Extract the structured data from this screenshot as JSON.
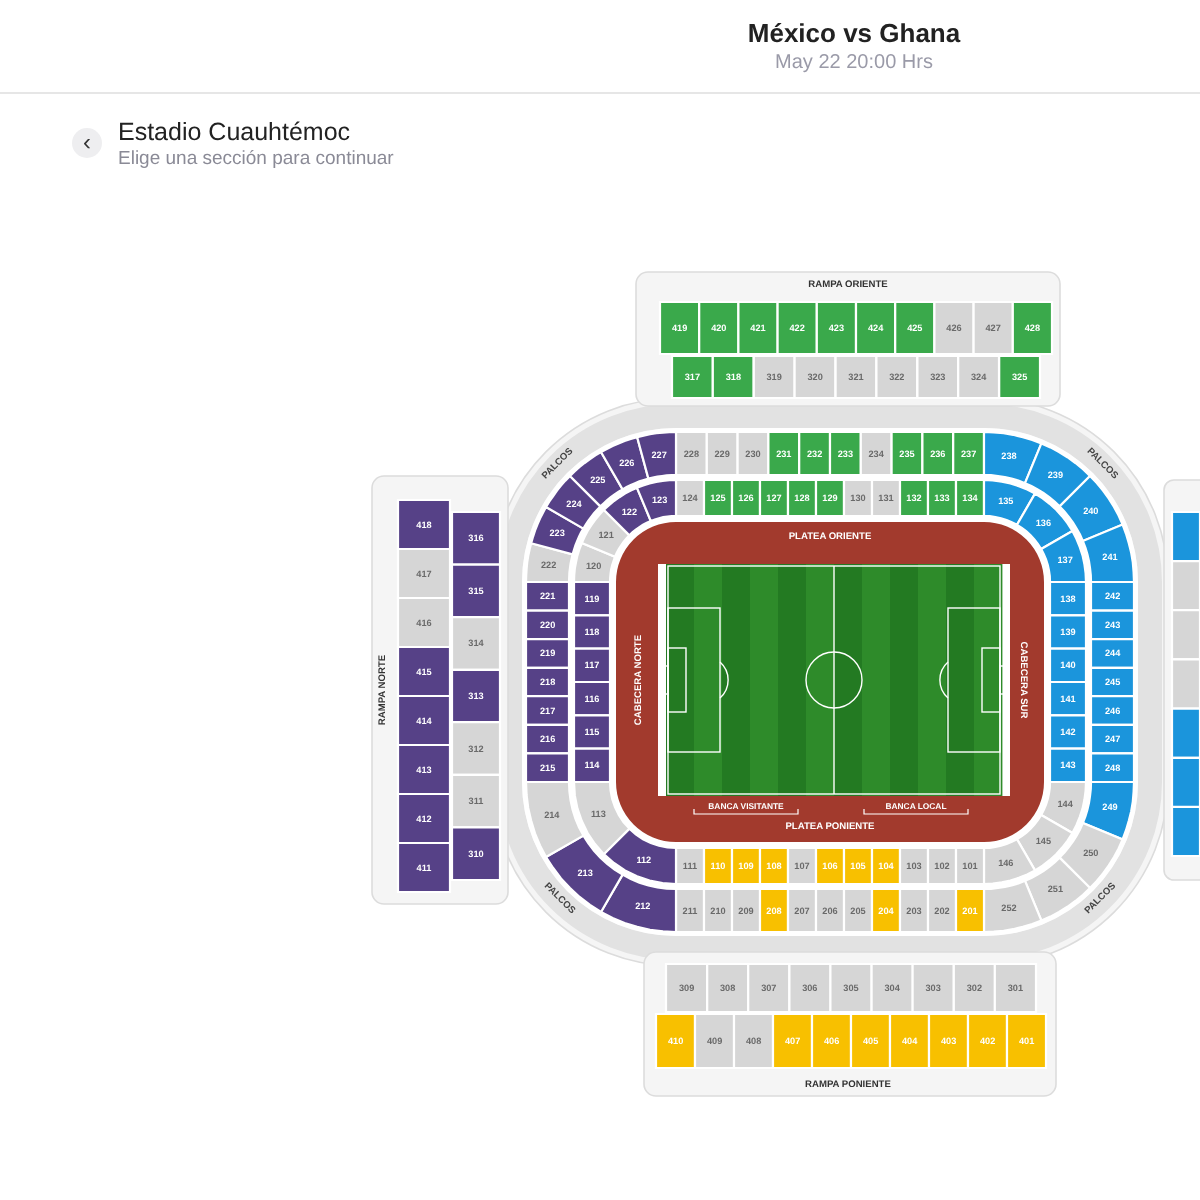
{
  "event": {
    "title": "México vs Ghana",
    "date": "May 22 20:00 Hrs"
  },
  "venue": {
    "back_button": "‹",
    "name": "Estadio Cuauhtémoc",
    "hint": "Elige una sección para continuar"
  },
  "map": {
    "labels": [
      {
        "kind": "ramp",
        "text": "RAMPA ORIENTE"
      },
      {
        "kind": "box",
        "text": "PALCOS"
      },
      {
        "kind": "box",
        "text": "PALCOS"
      },
      {
        "kind": "ramp",
        "text": "RAMPA NORTE"
      },
      {
        "kind": "stand",
        "text": "PLATEA ORIENTE"
      },
      {
        "kind": "stand",
        "text": "CABECERA NORTE"
      },
      {
        "kind": "stand",
        "text": "CABECERA SUR"
      },
      {
        "kind": "bench",
        "text": "BANCA VISITANTE"
      },
      {
        "kind": "bench",
        "text": "BANCA LOCAL"
      },
      {
        "kind": "stand",
        "text": "PLATEA PONIENTE"
      },
      {
        "kind": "box",
        "text": "PALCOS"
      },
      {
        "kind": "box",
        "text": "PALCOS"
      },
      {
        "kind": "ramp",
        "text": "RAMPA PONIENTE"
      }
    ],
    "oriente": {
      "rows": [
        [
          {
            "label": "419",
            "color": "#3aa94b"
          },
          {
            "label": "420",
            "color": "#3aa94b"
          },
          {
            "label": "421",
            "color": "#3aa94b"
          },
          {
            "label": "422",
            "color": "#3aa94b"
          },
          {
            "label": "423",
            "color": "#3aa94b"
          },
          {
            "label": "424",
            "color": "#3aa94b"
          },
          {
            "label": "425",
            "color": "#3aa94b"
          },
          {
            "label": "426",
            "color": "#d6d6d6"
          },
          {
            "label": "427",
            "color": "#d6d6d6"
          },
          {
            "label": "428",
            "color": "#3aa94b"
          }
        ],
        [
          {
            "label": "317",
            "color": "#3aa94b"
          },
          {
            "label": "318",
            "color": "#3aa94b"
          },
          {
            "label": "319",
            "color": "#d6d6d6"
          },
          {
            "label": "320",
            "color": "#d6d6d6"
          },
          {
            "label": "321",
            "color": "#d6d6d6"
          },
          {
            "label": "322",
            "color": "#d6d6d6"
          },
          {
            "label": "323",
            "color": "#d6d6d6"
          },
          {
            "label": "324",
            "color": "#d6d6d6"
          },
          {
            "label": "325",
            "color": "#3aa94b"
          }
        ]
      ]
    },
    "norte": {
      "columns": [
        [
          {
            "label": "418",
            "color": "#564187"
          },
          {
            "label": "417",
            "color": "#d6d6d6"
          },
          {
            "label": "416",
            "color": "#d6d6d6"
          },
          {
            "label": "415",
            "color": "#564187"
          },
          {
            "label": "414",
            "color": "#564187"
          },
          {
            "label": "413",
            "color": "#564187"
          },
          {
            "label": "412",
            "color": "#564187"
          },
          {
            "label": "411",
            "color": "#564187"
          }
        ],
        [
          {
            "label": "316",
            "color": "#564187"
          },
          {
            "label": "315",
            "color": "#564187"
          },
          {
            "label": "314",
            "color": "#d6d6d6"
          },
          {
            "label": "313",
            "color": "#564187"
          },
          {
            "label": "312",
            "color": "#d6d6d6"
          },
          {
            "label": "311",
            "color": "#d6d6d6"
          },
          {
            "label": "310",
            "color": "#564187"
          }
        ]
      ]
    },
    "sur": {
      "columns": [
        [
          {
            "color": "#1b95dc"
          },
          {
            "color": "#d6d6d6"
          },
          {
            "color": "#d6d6d6"
          },
          {
            "color": "#d6d6d6"
          },
          {
            "color": "#1b95dc"
          },
          {
            "color": "#1b95dc"
          },
          {
            "color": "#1b95dc"
          }
        ]
      ]
    },
    "poniente": {
      "rows": [
        [
          {
            "label": "309",
            "color": "#d6d6d6"
          },
          {
            "label": "308",
            "color": "#d6d6d6"
          },
          {
            "label": "307",
            "color": "#d6d6d6"
          },
          {
            "label": "306",
            "color": "#d6d6d6"
          },
          {
            "label": "305",
            "color": "#d6d6d6"
          },
          {
            "label": "304",
            "color": "#d6d6d6"
          },
          {
            "label": "303",
            "color": "#d6d6d6"
          },
          {
            "label": "302",
            "color": "#d6d6d6"
          },
          {
            "label": "301",
            "color": "#d6d6d6"
          }
        ],
        [
          {
            "label": "410",
            "color": "#f8c000"
          },
          {
            "label": "409",
            "color": "#d6d6d6"
          },
          {
            "label": "408",
            "color": "#d6d6d6"
          },
          {
            "label": "407",
            "color": "#f8c000"
          },
          {
            "label": "406",
            "color": "#f8c000"
          },
          {
            "label": "405",
            "color": "#f8c000"
          },
          {
            "label": "404",
            "color": "#f8c000"
          },
          {
            "label": "403",
            "color": "#f8c000"
          },
          {
            "label": "402",
            "color": "#f8c000"
          },
          {
            "label": "401",
            "color": "#f8c000"
          }
        ]
      ]
    },
    "ring_1": {
      "top": [
        {
          "label": "124",
          "color": "#d6d6d6"
        },
        {
          "label": "125",
          "color": "#3aa94b"
        },
        {
          "label": "126",
          "color": "#3aa94b"
        },
        {
          "label": "127",
          "color": "#3aa94b"
        },
        {
          "label": "128",
          "color": "#3aa94b"
        },
        {
          "label": "129",
          "color": "#3aa94b"
        },
        {
          "label": "130",
          "color": "#d6d6d6"
        },
        {
          "label": "131",
          "color": "#d6d6d6"
        },
        {
          "label": "132",
          "color": "#3aa94b"
        },
        {
          "label": "133",
          "color": "#3aa94b"
        },
        {
          "label": "134",
          "color": "#3aa94b"
        }
      ],
      "top_right": [
        {
          "label": "135",
          "color": "#1b95dc"
        },
        {
          "label": "136",
          "color": "#1b95dc"
        },
        {
          "label": "137",
          "color": "#1b95dc"
        }
      ],
      "right": [
        {
          "label": "138",
          "color": "#1b95dc"
        },
        {
          "label": "139",
          "color": "#1b95dc"
        },
        {
          "label": "140",
          "color": "#1b95dc"
        },
        {
          "label": "141",
          "color": "#1b95dc"
        },
        {
          "label": "142",
          "color": "#1b95dc"
        },
        {
          "label": "143",
          "color": "#1b95dc"
        }
      ],
      "bottom_right": [
        {
          "label": "144",
          "color": "#d6d6d6"
        },
        {
          "label": "145",
          "color": "#d6d6d6"
        },
        {
          "label": "146",
          "color": "#d6d6d6"
        }
      ],
      "bottom": [
        {
          "label": "111",
          "color": "#d6d6d6"
        },
        {
          "label": "110",
          "color": "#f8c000"
        },
        {
          "label": "109",
          "color": "#f8c000"
        },
        {
          "label": "108",
          "color": "#f8c000"
        },
        {
          "label": "107",
          "color": "#d6d6d6"
        },
        {
          "label": "106",
          "color": "#f8c000"
        },
        {
          "label": "105",
          "color": "#f8c000"
        },
        {
          "label": "104",
          "color": "#f8c000"
        },
        {
          "label": "103",
          "color": "#d6d6d6"
        },
        {
          "label": "102",
          "color": "#d6d6d6"
        },
        {
          "label": "101",
          "color": "#d6d6d6"
        }
      ],
      "bottom_left": [
        {
          "label": "112",
          "color": "#564187"
        },
        {
          "label": "113",
          "color": "#d6d6d6"
        }
      ],
      "left": [
        {
          "label": "119",
          "color": "#564187"
        },
        {
          "label": "118",
          "color": "#564187"
        },
        {
          "label": "117",
          "color": "#564187"
        },
        {
          "label": "116",
          "color": "#564187"
        },
        {
          "label": "115",
          "color": "#564187"
        },
        {
          "label": "114",
          "color": "#564187"
        }
      ],
      "top_left": [
        {
          "label": "120",
          "color": "#d6d6d6"
        },
        {
          "label": "121",
          "color": "#d6d6d6"
        },
        {
          "label": "122",
          "color": "#564187"
        },
        {
          "label": "123",
          "color": "#564187"
        }
      ]
    },
    "ring_2": {
      "top": [
        {
          "label": "228",
          "color": "#d6d6d6"
        },
        {
          "label": "229",
          "color": "#d6d6d6"
        },
        {
          "label": "230",
          "color": "#d6d6d6"
        },
        {
          "label": "231",
          "color": "#3aa94b"
        },
        {
          "label": "232",
          "color": "#3aa94b"
        },
        {
          "label": "233",
          "color": "#3aa94b"
        },
        {
          "label": "234",
          "color": "#d6d6d6"
        },
        {
          "label": "235",
          "color": "#3aa94b"
        },
        {
          "label": "236",
          "color": "#3aa94b"
        },
        {
          "label": "237",
          "color": "#3aa94b"
        }
      ],
      "top_right": [
        {
          "label": "238",
          "color": "#1b95dc"
        },
        {
          "label": "239",
          "color": "#1b95dc"
        },
        {
          "label": "240",
          "color": "#1b95dc"
        },
        {
          "label": "241",
          "color": "#1b95dc"
        }
      ],
      "right": [
        {
          "label": "242",
          "color": "#1b95dc"
        },
        {
          "label": "243",
          "color": "#1b95dc"
        },
        {
          "label": "244",
          "color": "#1b95dc"
        },
        {
          "label": "245",
          "color": "#1b95dc"
        },
        {
          "label": "246",
          "color": "#1b95dc"
        },
        {
          "label": "247",
          "color": "#1b95dc"
        },
        {
          "label": "248",
          "color": "#1b95dc"
        }
      ],
      "bottom_right": [
        {
          "label": "249",
          "color": "#1b95dc"
        },
        {
          "label": "250",
          "color": "#d6d6d6"
        },
        {
          "label": "251",
          "color": "#d6d6d6"
        },
        {
          "label": "252",
          "color": "#d6d6d6"
        }
      ],
      "bottom": [
        {
          "label": "211",
          "color": "#d6d6d6"
        },
        {
          "label": "210",
          "color": "#d6d6d6"
        },
        {
          "label": "209",
          "color": "#d6d6d6"
        },
        {
          "label": "208",
          "color": "#f8c000"
        },
        {
          "label": "207",
          "color": "#d6d6d6"
        },
        {
          "label": "206",
          "color": "#d6d6d6"
        },
        {
          "label": "205",
          "color": "#d6d6d6"
        },
        {
          "label": "204",
          "color": "#f8c000"
        },
        {
          "label": "203",
          "color": "#d6d6d6"
        },
        {
          "label": "202",
          "color": "#d6d6d6"
        },
        {
          "label": "201",
          "color": "#f8c000"
        }
      ],
      "bottom_left": [
        {
          "label": "212",
          "color": "#564187"
        },
        {
          "label": "213",
          "color": "#564187"
        },
        {
          "label": "214",
          "color": "#d6d6d6"
        }
      ],
      "left": [
        {
          "label": "221",
          "color": "#564187"
        },
        {
          "label": "220",
          "color": "#564187"
        },
        {
          "label": "219",
          "color": "#564187"
        },
        {
          "label": "218",
          "color": "#564187"
        },
        {
          "label": "217",
          "color": "#564187"
        },
        {
          "label": "216",
          "color": "#564187"
        },
        {
          "label": "215",
          "color": "#564187"
        }
      ],
      "top_left": [
        {
          "label": "222",
          "color": "#d6d6d6"
        },
        {
          "label": "223",
          "color": "#564187"
        },
        {
          "label": "224",
          "color": "#564187"
        },
        {
          "label": "225",
          "color": "#564187"
        },
        {
          "label": "226",
          "color": "#564187"
        },
        {
          "label": "227",
          "color": "#564187"
        }
      ]
    }
  }
}
